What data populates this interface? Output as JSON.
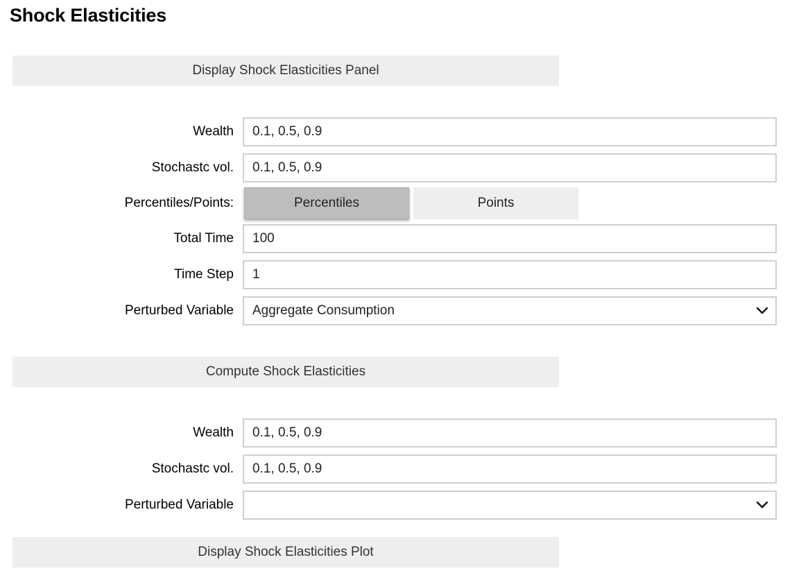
{
  "page": {
    "title": "Shock Elasticities"
  },
  "panel_button": {
    "label": "Display Shock Elasticities Panel"
  },
  "panel_form": {
    "wealth": {
      "label": "Wealth",
      "value": "0.1, 0.5, 0.9"
    },
    "stochastic_vol": {
      "label": "Stochastc vol.",
      "value": "0.1, 0.5, 0.9"
    },
    "percentiles_points": {
      "label": "Percentiles/Points:",
      "options": [
        "Percentiles",
        "Points"
      ],
      "selected": "Percentiles"
    },
    "total_time": {
      "label": "Total Time",
      "value": "100"
    },
    "time_step": {
      "label": "Time Step",
      "value": "1"
    },
    "perturbed_variable": {
      "label": "Perturbed Variable",
      "value": "Aggregate Consumption"
    }
  },
  "compute_button": {
    "label": "Compute Shock Elasticities"
  },
  "compute_form": {
    "wealth": {
      "label": "Wealth",
      "value": "0.1, 0.5, 0.9"
    },
    "stochastic_vol": {
      "label": "Stochastc vol.",
      "value": "0.1, 0.5, 0.9"
    },
    "perturbed_variable": {
      "label": "Perturbed Variable",
      "value": ""
    }
  },
  "plot_button": {
    "label": "Display Shock Elasticities Plot"
  },
  "colors": {
    "button_bg": "#eeeeee",
    "toggle_selected_bg": "#bdbdbd",
    "field_border": "#cfcfcf"
  },
  "icons": {
    "dropdown": "chevron-down-icon"
  }
}
